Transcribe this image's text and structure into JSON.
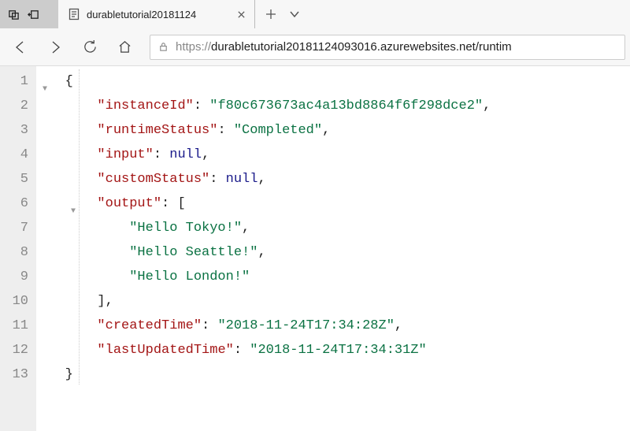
{
  "titlebar": {
    "tab_title": "durabletutorial20181124"
  },
  "toolbar": {
    "url_proto": "https://",
    "url_rest": "durabletutorial20181124093016.azurewebsites.net/runtim"
  },
  "gutter": [
    "1",
    "2",
    "3",
    "4",
    "5",
    "6",
    "7",
    "8",
    "9",
    "10",
    "11",
    "12",
    "13"
  ],
  "json": {
    "instanceId_key": "\"instanceId\"",
    "instanceId_val": "\"f80c673673ac4a13bd8864f6f298dce2\"",
    "runtimeStatus_key": "\"runtimeStatus\"",
    "runtimeStatus_val": "\"Completed\"",
    "input_key": "\"input\"",
    "input_val": "null",
    "customStatus_key": "\"customStatus\"",
    "customStatus_val": "null",
    "output_key": "\"output\"",
    "output_0": "\"Hello Tokyo!\"",
    "output_1": "\"Hello Seattle!\"",
    "output_2": "\"Hello London!\"",
    "createdTime_key": "\"createdTime\"",
    "createdTime_val": "\"2018-11-24T17:34:28Z\"",
    "lastUpdatedTime_key": "\"lastUpdatedTime\"",
    "lastUpdatedTime_val": "\"2018-11-24T17:34:31Z\""
  }
}
